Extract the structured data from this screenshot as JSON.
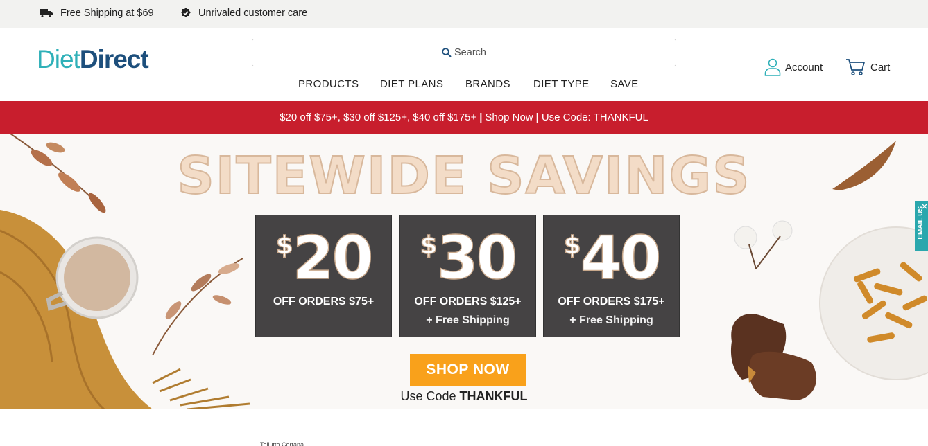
{
  "topbar": {
    "shipping": "Free Shipping at $69",
    "care": "Unrivaled customer care"
  },
  "logo": {
    "part1": "Diet",
    "part2": "Direct"
  },
  "search": {
    "placeholder": "Search"
  },
  "nav": [
    "PRODUCTS",
    "DIET PLANS",
    "BRANDS",
    "DIET TYPE",
    "SAVE"
  ],
  "account": {
    "label": "Account"
  },
  "cart": {
    "label": "Cart"
  },
  "promo": {
    "text": "$20 off $75+, $30 off $125+, $40 off $175+",
    "shop": "Shop Now",
    "code": "Use Code: THANKFUL"
  },
  "hero": {
    "headline": "SITEWIDE SAVINGS",
    "offers": [
      {
        "currency": "$",
        "amount": "20",
        "line1": "OFF ORDERS $75+",
        "line2": ""
      },
      {
        "currency": "$",
        "amount": "30",
        "line1": "OFF ORDERS $125+",
        "line2": "+ Free Shipping"
      },
      {
        "currency": "$",
        "amount": "40",
        "line1": "OFF ORDERS $175+",
        "line2": "+ Free Shipping"
      }
    ],
    "cta": "SHOP NOW",
    "code_prefix": "Use Code",
    "code": "THANKFUL"
  },
  "email_tab": "EMAIL US",
  "tooltip": "Tellutto Cortana",
  "colors": {
    "promo_bg": "#c81e2d",
    "cta": "#f9a11b",
    "brand_teal": "#2fb0b8",
    "brand_navy": "#1d4f7c"
  },
  "icons": [
    "truck-icon",
    "badge-check-icon",
    "search-icon",
    "user-icon",
    "cart-icon",
    "close-icon"
  ]
}
